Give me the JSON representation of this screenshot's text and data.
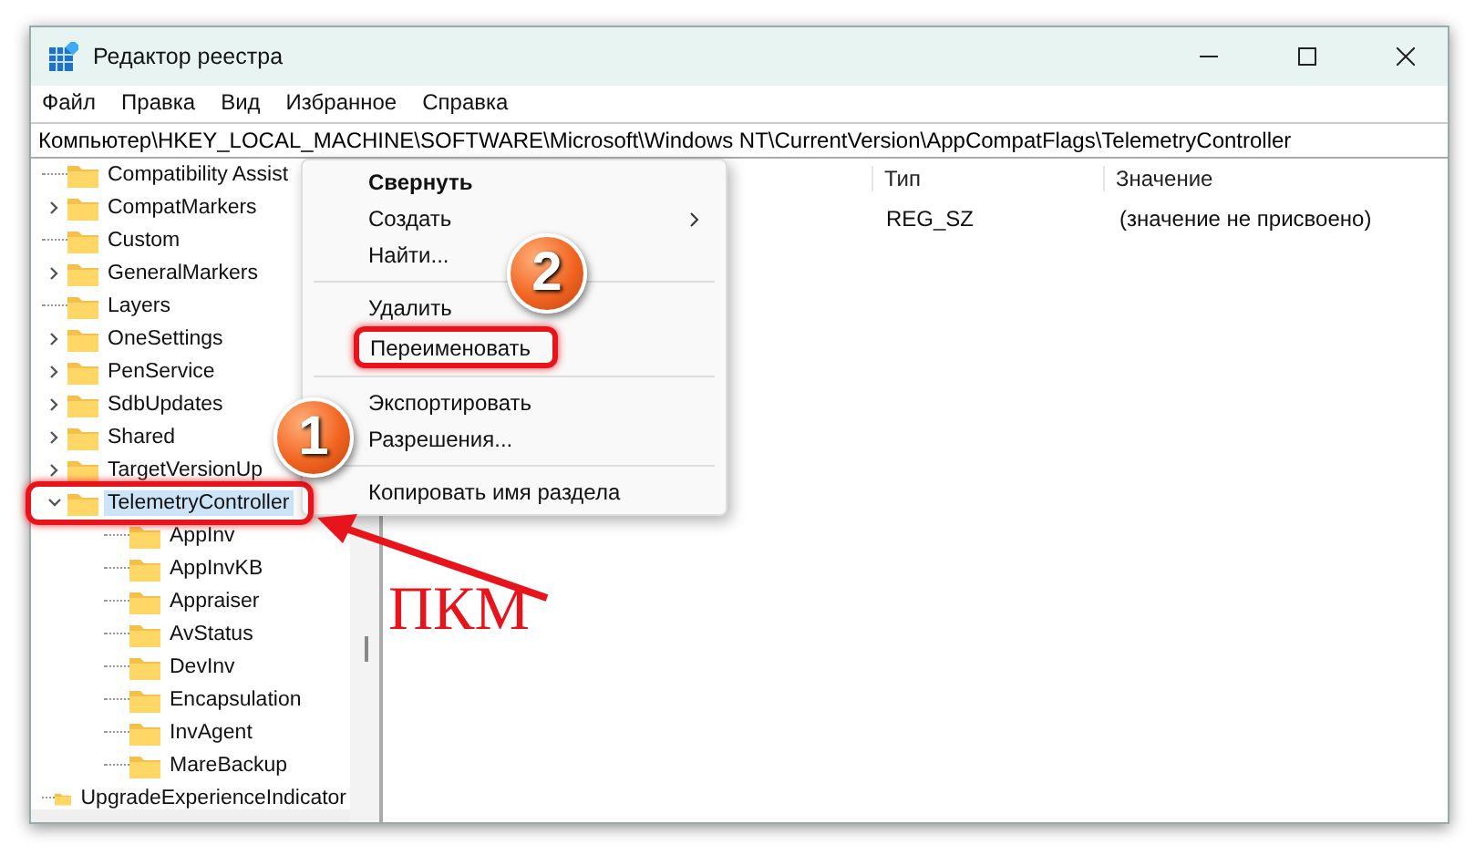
{
  "window": {
    "title": "Редактор реестра"
  },
  "menu_bar": [
    "Файл",
    "Правка",
    "Вид",
    "Избранное",
    "Справка"
  ],
  "address": "Компьютер\\HKEY_LOCAL_MACHINE\\SOFTWARE\\Microsoft\\Windows NT\\CurrentVersion\\AppCompatFlags\\TelemetryController",
  "tree": [
    {
      "label": "Compatibility Assist",
      "expandable": false,
      "selected": false
    },
    {
      "label": "CompatMarkers",
      "expandable": true,
      "expanded": false,
      "selected": false
    },
    {
      "label": "Custom",
      "expandable": false,
      "selected": false
    },
    {
      "label": "GeneralMarkers",
      "expandable": true,
      "expanded": false,
      "selected": false
    },
    {
      "label": "Layers",
      "expandable": false,
      "selected": false
    },
    {
      "label": "OneSettings",
      "expandable": true,
      "expanded": false,
      "selected": false
    },
    {
      "label": "PenService",
      "expandable": true,
      "expanded": false,
      "selected": false
    },
    {
      "label": "SdbUpdates",
      "expandable": true,
      "expanded": false,
      "selected": false
    },
    {
      "label": "Shared",
      "expandable": true,
      "expanded": false,
      "selected": false
    },
    {
      "label": "TargetVersionUp",
      "expandable": true,
      "expanded": false,
      "selected": false
    },
    {
      "label": "TelemetryController",
      "expandable": true,
      "expanded": true,
      "selected": true,
      "children": [
        {
          "label": "AppInv",
          "expandable": false,
          "selected": false
        },
        {
          "label": "AppInvKB",
          "expandable": false,
          "selected": false
        },
        {
          "label": "Appraiser",
          "expandable": false,
          "selected": false
        },
        {
          "label": "AvStatus",
          "expandable": false,
          "selected": false
        },
        {
          "label": "DevInv",
          "expandable": false,
          "selected": false
        },
        {
          "label": "Encapsulation",
          "expandable": false,
          "selected": false
        },
        {
          "label": "InvAgent",
          "expandable": false,
          "selected": false
        },
        {
          "label": "MareBackup",
          "expandable": false,
          "selected": false
        }
      ]
    },
    {
      "label": "UpgradeExperienceIndicator",
      "expandable": false,
      "selected": false
    }
  ],
  "values_table": {
    "columns": [
      "Тип",
      "Значение"
    ],
    "rows": [
      {
        "type": "REG_SZ",
        "value": "(значение не присвоено)"
      }
    ]
  },
  "context_menu": [
    {
      "kind": "item",
      "label": "Свернуть",
      "bold": true,
      "submenu": false,
      "highlighted": false
    },
    {
      "kind": "item",
      "label": "Создать",
      "bold": false,
      "submenu": true,
      "highlighted": false
    },
    {
      "kind": "item",
      "label": "Найти...",
      "bold": false,
      "submenu": false,
      "highlighted": false
    },
    {
      "kind": "separator"
    },
    {
      "kind": "item",
      "label": "Удалить",
      "bold": false,
      "submenu": false,
      "highlighted": false
    },
    {
      "kind": "item",
      "label": "Переименовать",
      "bold": false,
      "submenu": false,
      "highlighted": true
    },
    {
      "kind": "separator"
    },
    {
      "kind": "item",
      "label": "Экспортировать",
      "bold": false,
      "submenu": false,
      "highlighted": false
    },
    {
      "kind": "item",
      "label": "Разрешения...",
      "bold": false,
      "submenu": false,
      "highlighted": false
    },
    {
      "kind": "separator"
    },
    {
      "kind": "item",
      "label": "Копировать имя раздела",
      "bold": false,
      "submenu": false,
      "highlighted": false
    }
  ],
  "annotations": {
    "badges": [
      "1",
      "2"
    ],
    "caption": "ПКМ"
  }
}
